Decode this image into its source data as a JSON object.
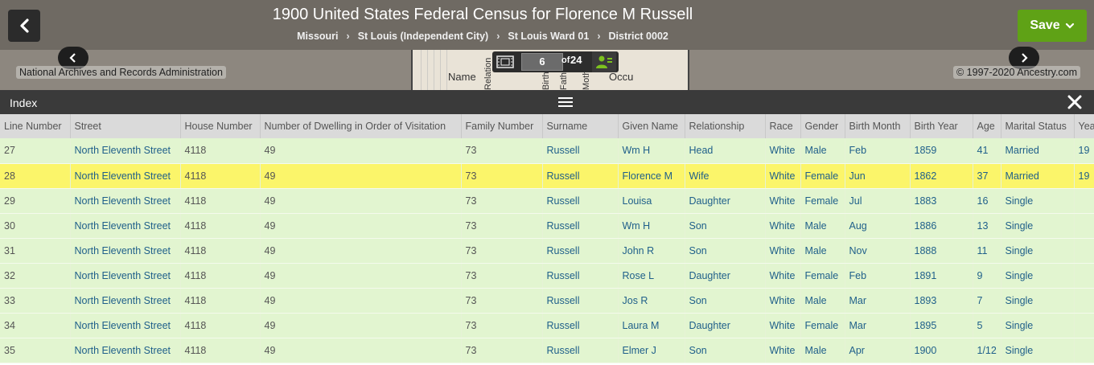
{
  "header": {
    "title": "1900 United States Federal Census for Florence M Russell",
    "breadcrumbs": [
      "Missouri",
      "St Louis (Independent City)",
      "St Louis Ward 01",
      "District 0002"
    ],
    "breadcrumb_separator": "›",
    "save_label": "Save",
    "back_icon": "chevron-left-icon"
  },
  "viewer": {
    "source_caption": "National Archives and Records Administration",
    "copyright_caption": "© 1997-2020 Ancestry.com",
    "page_current": "6",
    "page_of": "of",
    "page_total": "24",
    "image_snippets": [
      "Name",
      "Relation",
      "Birth",
      "Father",
      "Mother",
      "Occu"
    ]
  },
  "index": {
    "title": "Index",
    "columns": [
      "Line Number",
      "Street",
      "House Number",
      "Number of Dwelling in Order of Visitation",
      "Family Number",
      "Surname",
      "Given Name",
      "Relationship",
      "Race",
      "Gender",
      "Birth Month",
      "Birth Year",
      "Age",
      "Marital Status",
      "Years"
    ],
    "rows": [
      [
        "27",
        "North Eleventh Street",
        "4118",
        "49",
        "73",
        "Russell",
        "Wm H",
        "Head",
        "White",
        "Male",
        "Feb",
        "1859",
        "41",
        "Married",
        "19"
      ],
      [
        "28",
        "North Eleventh Street",
        "4118",
        "49",
        "73",
        "Russell",
        "Florence M",
        "Wife",
        "White",
        "Female",
        "Jun",
        "1862",
        "37",
        "Married",
        "19"
      ],
      [
        "29",
        "North Eleventh Street",
        "4118",
        "49",
        "73",
        "Russell",
        "Louisa",
        "Daughter",
        "White",
        "Female",
        "Jul",
        "1883",
        "16",
        "Single",
        ""
      ],
      [
        "30",
        "North Eleventh Street",
        "4118",
        "49",
        "73",
        "Russell",
        "Wm H",
        "Son",
        "White",
        "Male",
        "Aug",
        "1886",
        "13",
        "Single",
        ""
      ],
      [
        "31",
        "North Eleventh Street",
        "4118",
        "49",
        "73",
        "Russell",
        "John R",
        "Son",
        "White",
        "Male",
        "Nov",
        "1888",
        "11",
        "Single",
        ""
      ],
      [
        "32",
        "North Eleventh Street",
        "4118",
        "49",
        "73",
        "Russell",
        "Rose L",
        "Daughter",
        "White",
        "Female",
        "Feb",
        "1891",
        "9",
        "Single",
        ""
      ],
      [
        "33",
        "North Eleventh Street",
        "4118",
        "49",
        "73",
        "Russell",
        "Jos R",
        "Son",
        "White",
        "Male",
        "Mar",
        "1893",
        "7",
        "Single",
        ""
      ],
      [
        "34",
        "North Eleventh Street",
        "4118",
        "49",
        "73",
        "Russell",
        "Laura M",
        "Daughter",
        "White",
        "Female",
        "Mar",
        "1895",
        "5",
        "Single",
        ""
      ],
      [
        "35",
        "North Eleventh Street",
        "4118",
        "49",
        "73",
        "Russell",
        "Elmer J",
        "Son",
        "White",
        "Male",
        "Apr",
        "1900",
        "1/12",
        "Single",
        ""
      ]
    ],
    "selected_row": 1
  },
  "colors": {
    "save_green": "#5fa216",
    "row_green": "#e2f5d0",
    "row_selected": "#fbf56a",
    "link_blue": "#1f5f8a"
  }
}
